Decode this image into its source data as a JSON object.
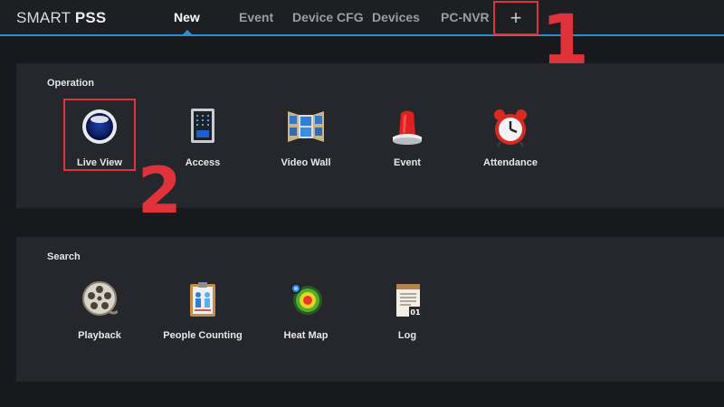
{
  "app": {
    "brand_light": "SMART ",
    "brand_bold": "PSS"
  },
  "tabs": [
    {
      "label": "New",
      "active": true
    },
    {
      "label": "Event"
    },
    {
      "label": "Device CFG"
    },
    {
      "label": "Devices"
    },
    {
      "label": "PC-NVR"
    }
  ],
  "plus_label": "+",
  "callouts": {
    "one": "1",
    "two": "2"
  },
  "operation": {
    "title": "Operation",
    "items": [
      {
        "label": "Live View",
        "icon": "camera-lens-icon"
      },
      {
        "label": "Access",
        "icon": "access-keypad-icon"
      },
      {
        "label": "Video Wall",
        "icon": "video-wall-icon"
      },
      {
        "label": "Event",
        "icon": "alarm-light-icon"
      },
      {
        "label": "Attendance",
        "icon": "alarm-clock-icon"
      }
    ]
  },
  "search": {
    "title": "Search",
    "items": [
      {
        "label": "Playback",
        "icon": "film-reel-icon"
      },
      {
        "label": "People Counting",
        "icon": "people-counting-icon"
      },
      {
        "label": "Heat Map",
        "icon": "heat-map-icon"
      },
      {
        "label": "Log",
        "icon": "log-calendar-icon"
      }
    ]
  },
  "colors": {
    "accent": "#2a8fd1",
    "annotation": "#e0323a",
    "panel": "#25272c",
    "background": "#17191c"
  }
}
